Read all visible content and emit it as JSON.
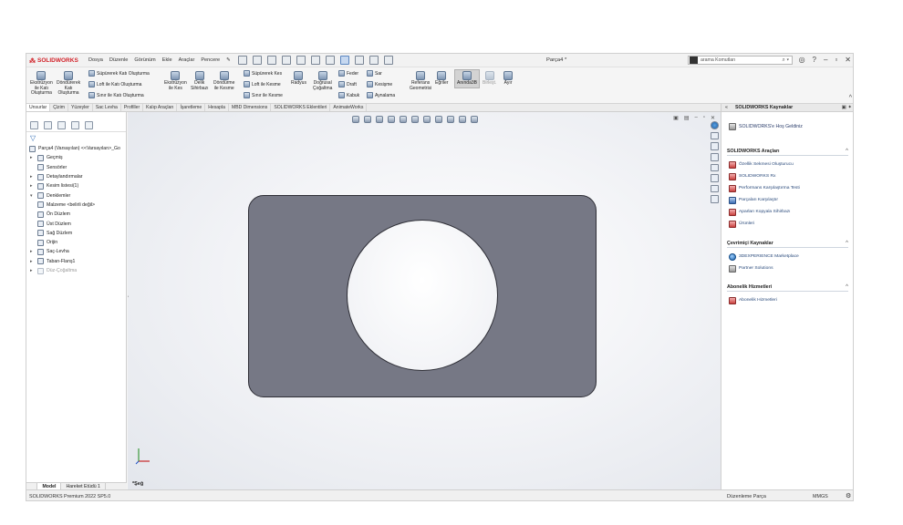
{
  "app": {
    "brand": "SOLIDWORKS",
    "doc_title": "Parça4 *",
    "menu": [
      "Dosya",
      "Düzenle",
      "Görünüm",
      "Ekle",
      "Araçlar",
      "Pencere"
    ],
    "search_placeholder": "arama Komutları"
  },
  "command_manager": {
    "extrude_boss": "Ekstrüzyon\nile Katı\nOluşturma",
    "revolve_boss": "Döndürerek\nKatı\nOluşturma",
    "sweep_boss": "Süpürerek Katı Oluşturma",
    "loft_boss": "Loft ile Katı Oluşturma",
    "boundary_boss": "Sınır ile Katı Oluşturma",
    "extrude_cut": "Ekstrüzyon\nile Kes",
    "hole_wizard": "Delik\nSihirbazı",
    "revolve_cut": "Döndürme\nile Kesme",
    "swept_cut": "Süpürerek Kes",
    "lofted_cut": "Loft ile Kesme",
    "boundary_cut": "Sınır ile Kesme",
    "fillet": "Radyus",
    "linear_pattern": "Doğrusal\nÇoğaltma",
    "rib": "Feder",
    "draft": "Draft",
    "shell": "Kabuk",
    "wrap": "Sar",
    "intersect": "Kesişme",
    "mirror": "Aynalama",
    "reference_geometry": "Referans\nGeometrisi",
    "curves": "Eğriler",
    "instant3d": "Anında3B",
    "cut_list": "Birleşt.",
    "split": "Ayır"
  },
  "tabs": [
    "Unsurlar",
    "Çizim",
    "Yüzeyler",
    "Sac Levha",
    "Profiller",
    "Kalıp Araçları",
    "İşaretleme",
    "Hesapla",
    "MBD Dimensions",
    "SOLIDWORKS Eklentileri",
    "AnimateWorks"
  ],
  "feature_tree": {
    "root": "Parça4 (Varsayılan) <<Varsayılan>_Go",
    "nodes": [
      {
        "label": "Geçmiş",
        "exp": "▸"
      },
      {
        "label": "Sensörler",
        "exp": ""
      },
      {
        "label": "Detaylandırmalar",
        "exp": "▸"
      },
      {
        "label": "Kesim listesi(1)",
        "exp": "▸"
      },
      {
        "label": "Denklemler",
        "exp": "▾"
      },
      {
        "label": "Malzeme <belirli değil>",
        "exp": ""
      },
      {
        "label": "Ön Düzlem",
        "exp": ""
      },
      {
        "label": "Üst Düzlem",
        "exp": ""
      },
      {
        "label": "Sağ Düzlem",
        "exp": ""
      },
      {
        "label": "Orijin",
        "exp": ""
      },
      {
        "label": "Saç-Levha",
        "exp": "▸"
      },
      {
        "label": "Taban-Flanş1",
        "exp": "▸"
      },
      {
        "label": "Düz-Çoğaltma",
        "exp": "▸"
      }
    ],
    "bottom_tabs": [
      "Model",
      "Hareket Etüdü 1"
    ]
  },
  "viewport": {
    "sketch_label": "*Şeğ"
  },
  "task_pane": {
    "title": "SOLIDWORKS Kaynaklar",
    "welcome": "SOLIDWORKS'e Hoş Geldiniz",
    "tools_header": "SOLIDWORKS Araçları",
    "tools": [
      "Özellik Sekmesi Oluşturucu",
      "SOLIDWORKS Rx",
      "Performans Karşılaştırma Testi",
      "Parçaları Karşılaştır",
      "Aparları Kopyala Sihirbazı",
      "Ürünleri"
    ],
    "online_header": "Çevrimiçi Kaynaklar",
    "online": [
      "3DEXPERIENCE Marketplace",
      "Partner Solutions"
    ],
    "sub_header": "Abonelik Hizmetleri",
    "sub": [
      "Abonelik Hizmetleri"
    ]
  },
  "status_bar": {
    "left": "SOLIDWORKS Premium 2022 SP5.0",
    "mode": "Düzenleme Parça",
    "units": "MMGS"
  }
}
